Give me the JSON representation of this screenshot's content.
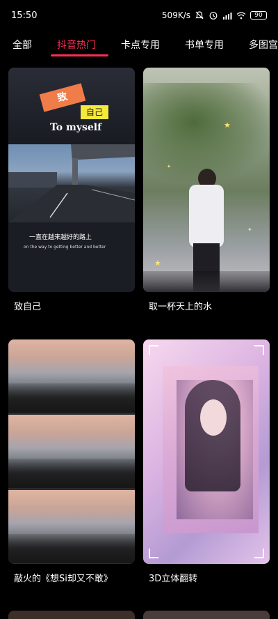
{
  "status_bar": {
    "time": "15:50",
    "net_speed": "509K/s",
    "battery": "90"
  },
  "tabs": [
    {
      "label": "全部"
    },
    {
      "label": "抖音热门"
    },
    {
      "label": "卡点专用"
    },
    {
      "label": "书单专用"
    },
    {
      "label": "多图宫格"
    }
  ],
  "active_tab": "抖音热门",
  "cards": [
    {
      "title": "致自己",
      "overlay": {
        "word": "致",
        "sub": "自己",
        "english": "To myself",
        "lyric": "一直在越来越好的路上",
        "lyric_en": "on the way to getting better and better"
      }
    },
    {
      "title": "取一杯天上的水"
    },
    {
      "title": "敲火的《想Si却又不敢》"
    },
    {
      "title": "3D立体翻转"
    }
  ],
  "colors": {
    "accent": "#ff2d55",
    "background": "#000000",
    "badge_orange": "#f07c4a",
    "badge_yellow": "#f5e93d"
  },
  "icons": {
    "mute": "bell-off-icon",
    "alarm": "alarm-icon",
    "signal": "signal-icon",
    "wifi": "wifi-icon",
    "battery": "battery-icon"
  }
}
